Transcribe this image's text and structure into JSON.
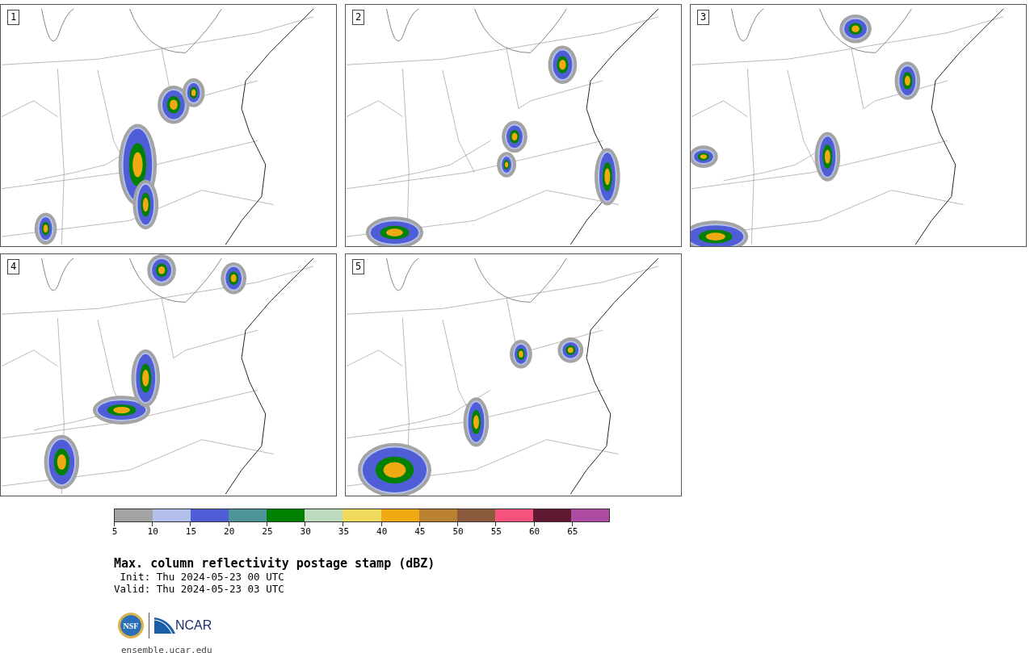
{
  "panels": [
    {
      "label": "1"
    },
    {
      "label": "2"
    },
    {
      "label": "3"
    },
    {
      "label": "4"
    },
    {
      "label": "5"
    }
  ],
  "colorbar": {
    "bins": [
      {
        "color": "#a3a3a3"
      },
      {
        "color": "#b4c0ec"
      },
      {
        "color": "#4f5ed6"
      },
      {
        "color": "#4d9498"
      },
      {
        "color": "#018102"
      },
      {
        "color": "#bedcbd"
      },
      {
        "color": "#f0da5c"
      },
      {
        "color": "#f0aa13"
      },
      {
        "color": "#ba8230"
      },
      {
        "color": "#8b5a3d"
      },
      {
        "color": "#f5527d"
      },
      {
        "color": "#611833"
      },
      {
        "color": "#ad4ba3"
      }
    ],
    "ticks": [
      "5",
      "10",
      "15",
      "20",
      "25",
      "30",
      "35",
      "40",
      "45",
      "50",
      "55",
      "60",
      "65"
    ]
  },
  "title": "Max. column reflectivity postage stamp (dBZ)",
  "init": " Init: Thu 2024-05-23 00 UTC",
  "valid": "Valid: Thu 2024-05-23 03 UTC",
  "logos": {
    "nsf": "NSF",
    "ncar": "NCAR"
  },
  "url": "ensemble.ucar.edu"
}
